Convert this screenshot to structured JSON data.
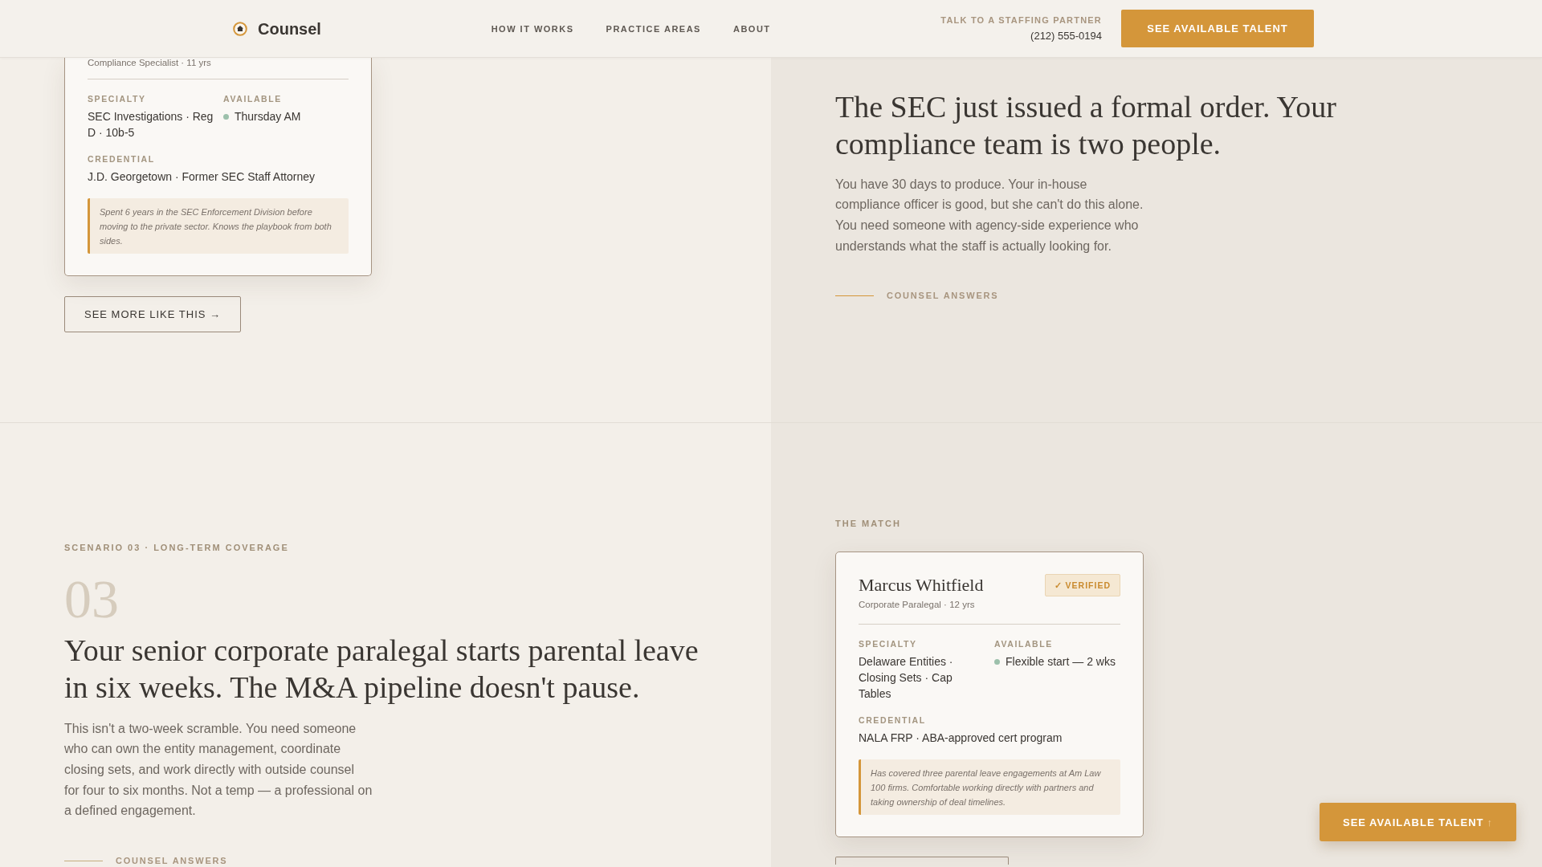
{
  "header": {
    "brand": "Counsel",
    "nav": [
      {
        "label": "HOW IT WORKS"
      },
      {
        "label": "PRACTICE AREAS"
      },
      {
        "label": "ABOUT"
      }
    ],
    "contact": {
      "label": "TALK TO A STAFFING PARTNER",
      "phone": "(212) 555-0194"
    },
    "cta": "SEE AVAILABLE TALENT"
  },
  "sections": [
    {
      "columns": [
        {
          "kind": "match",
          "card": {
            "subtitle": "Compliance Specialist · 11 yrs",
            "fields": [
              {
                "kind": "text",
                "label": "SPECIALTY",
                "value": "SEC Investigations · Reg D · 10b-5"
              },
              {
                "kind": "status",
                "label": "AVAILABLE",
                "value": "Thursday AM"
              },
              {
                "kind": "full",
                "label": "CREDENTIAL",
                "value": "J.D. Georgetown · Former SEC Staff Attorney"
              }
            ],
            "note": "Spent 6 years in the SEC Enforcement Division before moving to the private sector. Knows the playbook from both sides."
          },
          "more_button": "SEE MORE LIKE THIS →"
        },
        {
          "kind": "scenario",
          "heading": "The SEC just issued a formal order. Your compliance team is two people.",
          "body": "You have 30 days to produce. Your in-house compliance officer is good, but she can't do this alone. You need someone with agency-side experience who understands what the staff is actually looking for.",
          "answer_label": "COUNSEL ANSWERS"
        }
      ]
    },
    {
      "columns": [
        {
          "kind": "scenario",
          "eyebrow": "SCENARIO 03 · LONG-TERM COVERAGE",
          "number": "03",
          "heading": "Your senior corporate paralegal starts parental leave in six weeks. The M&A pipeline doesn't pause.",
          "body": "This isn't a two-week scramble. You need someone who can own the entity management, coordinate closing sets, and work directly with outside counsel for four to six months. Not a temp — a professional on a defined engagement.",
          "answer_label": "COUNSEL ANSWERS"
        },
        {
          "kind": "match",
          "label": "THE MATCH",
          "card": {
            "name": "Marcus Whitfield",
            "badge": "✓ VERIFIED",
            "subtitle": "Corporate Paralegal · 12 yrs",
            "fields": [
              {
                "kind": "text",
                "label": "SPECIALTY",
                "value": "Delaware Entities · Closing Sets · Cap Tables"
              },
              {
                "kind": "status",
                "label": "AVAILABLE",
                "value": "Flexible start — 2 wks"
              },
              {
                "kind": "full",
                "label": "CREDENTIAL",
                "value": "NALA FRP · ABA-approved cert program"
              }
            ],
            "note": "Has covered three parental leave engagements at Am Law 100 firms. Comfortable working directly with partners and taking ownership of deal timelines."
          }
        }
      ]
    }
  ],
  "floating_cta": {
    "label": "SEE AVAILABLE TALENT",
    "arrow": "↑"
  }
}
